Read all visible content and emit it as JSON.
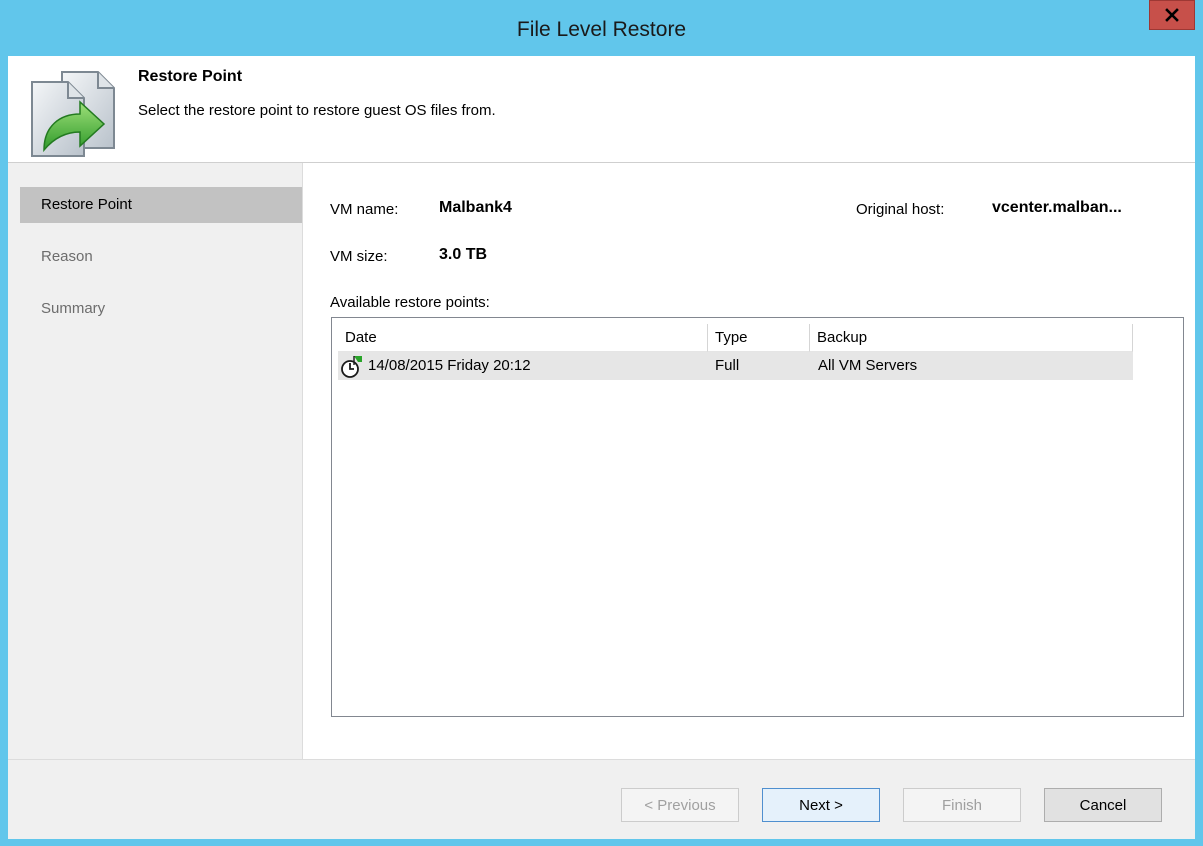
{
  "window": {
    "title": "File Level Restore"
  },
  "header": {
    "title": "Restore Point",
    "subtitle": "Select the restore point to restore guest OS files from."
  },
  "sidebar": {
    "items": [
      {
        "label": "Restore Point",
        "selected": true
      },
      {
        "label": "Reason",
        "selected": false
      },
      {
        "label": "Summary",
        "selected": false
      }
    ]
  },
  "vm": {
    "name_label": "VM name:",
    "name": "Malbank4",
    "host_label": "Original host:",
    "host": "vcenter.malban...",
    "size_label": "VM size:",
    "size": "3.0 TB"
  },
  "restore_points": {
    "label": "Available restore points:",
    "columns": [
      "Date",
      "Type",
      "Backup"
    ],
    "rows": [
      {
        "date": "14/08/2015 Friday 20:12",
        "type": "Full",
        "backup": "All VM Servers"
      }
    ]
  },
  "buttons": {
    "previous": "< Previous",
    "next": "Next >",
    "finish": "Finish",
    "cancel": "Cancel"
  },
  "colors": {
    "titlebar": "#61c6eb",
    "close": "#c7504a",
    "selected_nav": "#c2c2c2",
    "sidebar": "#f0f0f0"
  },
  "icons": {
    "header": "restore-document-arrow-icon",
    "row": "restore-point-clock-icon",
    "close": "close-icon"
  }
}
